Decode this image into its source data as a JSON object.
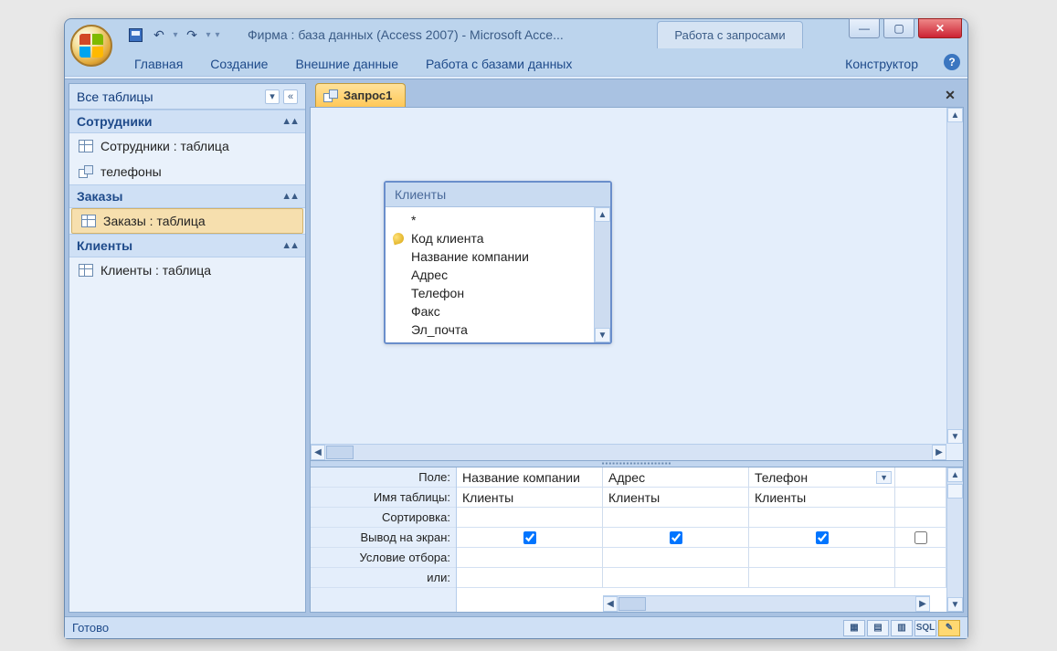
{
  "title": "Фирма : база данных (Access 2007)  -  Microsoft Acce...",
  "contextual_tab": "Работа с запросами",
  "ribbon_tabs": [
    "Главная",
    "Создание",
    "Внешние данные",
    "Работа с базами данных"
  ],
  "ribbon_context_tab": "Конструктор",
  "nav_header": "Все таблицы",
  "nav_groups": [
    {
      "name": "Сотрудники",
      "items": [
        {
          "icon": "table",
          "label": "Сотрудники : таблица",
          "selected": false
        },
        {
          "icon": "query",
          "label": "телефоны",
          "selected": false
        }
      ]
    },
    {
      "name": "Заказы",
      "items": [
        {
          "icon": "table",
          "label": "Заказы : таблица",
          "selected": true
        }
      ]
    },
    {
      "name": "Клиенты",
      "items": [
        {
          "icon": "table",
          "label": "Клиенты : таблица",
          "selected": false
        }
      ]
    }
  ],
  "doc_tab": "Запрос1",
  "table_box": {
    "title": "Клиенты",
    "fields": [
      "*",
      "Код клиента",
      "Название компании",
      "Адрес",
      "Телефон",
      "Факс",
      "Эл_почта"
    ],
    "key_field_index": 1
  },
  "grid_labels": [
    "Поле:",
    "Имя таблицы:",
    "Сортировка:",
    "Вывод на экран:",
    "Условие отбора:",
    "или:"
  ],
  "grid_columns": [
    {
      "field": "Название компании",
      "table": "Клиенты",
      "sort": "",
      "show": true,
      "criteria": "",
      "or": ""
    },
    {
      "field": "Адрес",
      "table": "Клиенты",
      "sort": "",
      "show": true,
      "criteria": "",
      "or": ""
    },
    {
      "field": "Телефон",
      "table": "Клиенты",
      "sort": "",
      "show": true,
      "criteria": "",
      "or": "",
      "dropdown": true
    }
  ],
  "status": "Готово",
  "view_buttons": [
    "▦",
    "▤",
    "▥",
    "SQL",
    "✎"
  ]
}
